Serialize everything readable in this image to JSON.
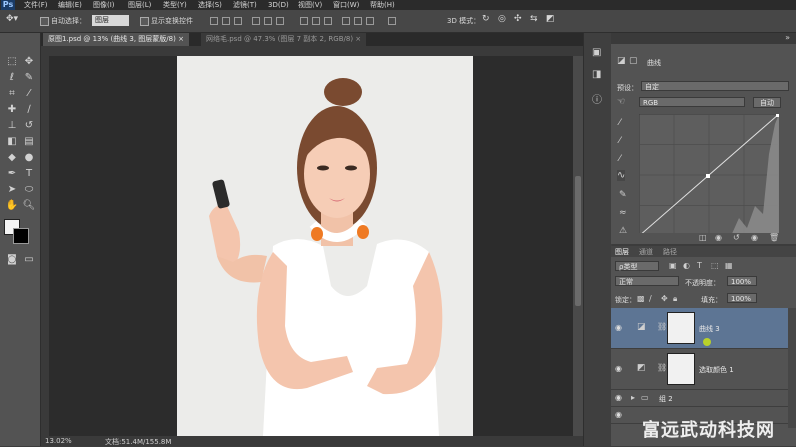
{
  "app": {
    "logo": "Ps"
  },
  "menu": [
    "文件(F)",
    "编辑(E)",
    "图像(I)",
    "图层(L)",
    "类型(Y)",
    "选择(S)",
    "滤镜(T)",
    "3D(D)",
    "视图(V)",
    "窗口(W)",
    "帮助(H)"
  ],
  "options_bar": {
    "auto_select_label": "自动选择：",
    "auto_select_value": "图层",
    "show_transform_label": "显示变换控件",
    "mode_3d_label": "3D 模式："
  },
  "tabs": [
    {
      "label": "原图1.psd @ 13% (曲线 3, 图层蒙版/8) ×"
    },
    {
      "label": "网络毛.psd @ 47.3% (图层 7 副本 2, RGB/8) ×"
    }
  ],
  "status": {
    "zoom": "13.02%",
    "doc": "文档:51.4M/155.8M"
  },
  "properties": {
    "title": "曲线",
    "preset_label": "预设：",
    "preset_value": "自定",
    "channel_value": "RGB",
    "auto_button": "自动"
  },
  "layers_panel": {
    "tabs": [
      "图层",
      "通道",
      "路径"
    ],
    "filter_label": "ρ类型",
    "blend_mode": "正常",
    "opacity_label": "不透明度：",
    "opacity_value": "100%",
    "lock_label": "锁定：",
    "fill_label": "填充：",
    "fill_value": "100%",
    "layers": [
      {
        "name": "曲线 3",
        "selected": true
      },
      {
        "name": "选取颜色 1",
        "selected": false
      },
      {
        "name": "组 2",
        "selected": false
      }
    ]
  },
  "watermark": "富远武动科技网",
  "colors": {
    "accent": "#5d7594",
    "photo_bg": "#ececea",
    "orange": "#ef7a23"
  }
}
